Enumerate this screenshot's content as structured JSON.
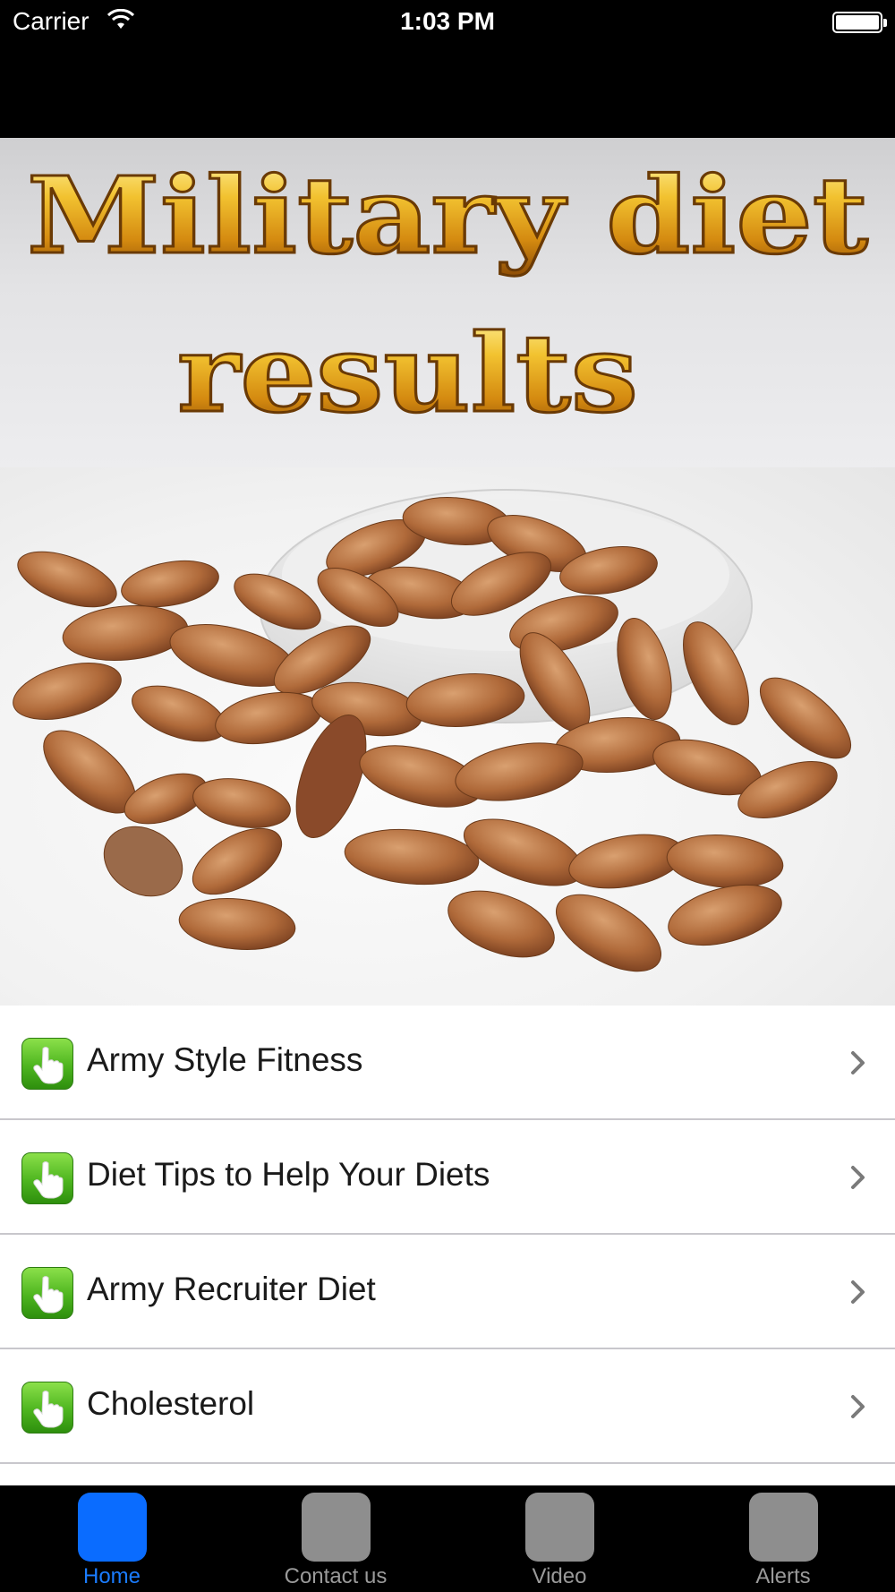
{
  "status_bar": {
    "carrier": "Carrier",
    "time": "1:03 PM"
  },
  "banner": {
    "title_line1": "Military diet",
    "title_line2": "results"
  },
  "photo": {
    "subject": "almonds-in-bowl"
  },
  "menu": {
    "items": [
      {
        "label": "Army Style Fitness",
        "icon": "pointing-hand-icon"
      },
      {
        "label": "Diet Tips to Help Your Diets",
        "icon": "pointing-hand-icon"
      },
      {
        "label": "Army Recruiter Diet",
        "icon": "pointing-hand-icon"
      },
      {
        "label": "Cholesterol",
        "icon": "pointing-hand-icon"
      }
    ]
  },
  "tabbar": {
    "tabs": [
      {
        "label": "Home",
        "active": true
      },
      {
        "label": "Contact us",
        "active": false
      },
      {
        "label": "Video",
        "active": false
      },
      {
        "label": "Alerts",
        "active": false
      }
    ]
  },
  "colors": {
    "active_tab": "#0a6cff",
    "active_tab_label": "#1a7cff",
    "inactive_tab": "#8e8e8e",
    "icon_green": "#4db51f",
    "title_gold": "#e0a020"
  }
}
